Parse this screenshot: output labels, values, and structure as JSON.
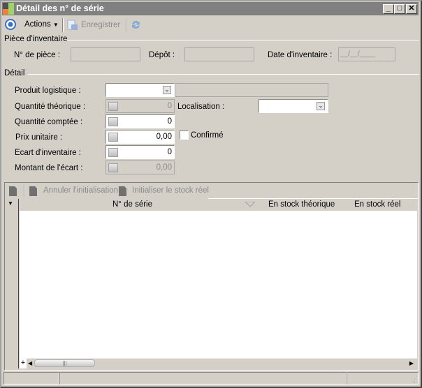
{
  "window": {
    "title": "Détail des n° de série"
  },
  "toolbar": {
    "actions_label": "Actions",
    "save_label": "Enregistrer"
  },
  "piece": {
    "section": "Pièce d'inventaire",
    "num_label": "N° de pièce :",
    "num_value": "",
    "depot_label": "Dépôt :",
    "depot_value": "",
    "date_label": "Date d'inventaire :",
    "date_value": "__/__/____"
  },
  "detail": {
    "section": "Détail",
    "produit_label": "Produit logistique :",
    "produit_value": "",
    "produit_desc": "",
    "qte_theo_label": "Quantité théorique :",
    "qte_theo_value": "0",
    "localisation_label": "Localisation :",
    "localisation_value": "",
    "qte_comptee_label": "Quantité comptée :",
    "qte_comptee_value": "0",
    "prix_label": "Prix unitaire :",
    "prix_value": "0,00",
    "confirme_label": "Confirmé",
    "confirme_checked": false,
    "ecart_label": "Ecart d'inventaire :",
    "ecart_value": "0",
    "montant_label": "Montant de l'écart :",
    "montant_value": "0,00"
  },
  "grid": {
    "cancel_init_label": "Annuler l'initialisation",
    "init_label": "Initialiser le stock réel",
    "columns": [
      "N° de série",
      "En stock théorique",
      "En stock réel"
    ],
    "rows": []
  },
  "statusbar": {
    "panels": [
      "",
      "",
      ""
    ]
  }
}
